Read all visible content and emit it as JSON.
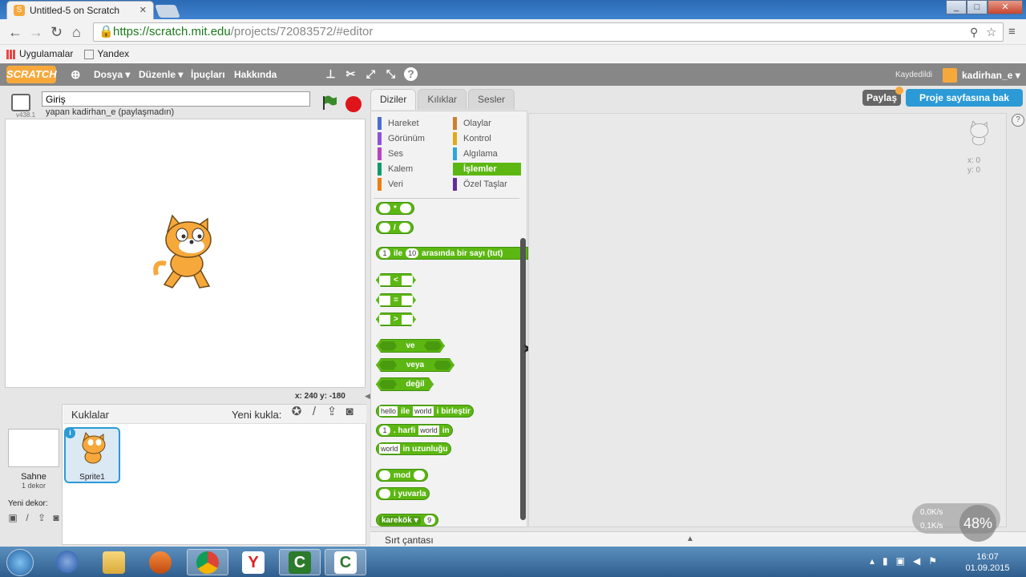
{
  "browser": {
    "tab_title": "Untitled-5 on Scratch",
    "url_scheme": "https://",
    "url_host": "scratch.mit.edu",
    "url_path": "/projects/72083572/#editor",
    "bookmarks": [
      "Uygulamalar",
      "Yandex"
    ]
  },
  "menubar": {
    "logo": "SCRATCH",
    "items": [
      "Dosya ▾",
      "Düzenle ▾",
      "İpuçları",
      "Hakkında"
    ],
    "saved": "Kaydedildi",
    "user": "kadirhan_e ▾"
  },
  "stage": {
    "project_name": "Giriş",
    "byline": "yapan kadirhan_e (paylaşmadın)",
    "version": "v438.1",
    "coords": "x: 240  y: -180"
  },
  "sprites": {
    "header": "Kuklalar",
    "new_sprite": "Yeni kukla:",
    "stage_label": "Sahne",
    "backdrop_count": "1 dekor",
    "new_backdrop": "Yeni dekor:",
    "sprite_name": "Sprite1"
  },
  "tabs": [
    "Diziler",
    "Kılıklar",
    "Sesler"
  ],
  "categories": {
    "left": [
      "Hareket",
      "Görünüm",
      "Ses",
      "Kalem",
      "Veri"
    ],
    "right": [
      "Olaylar",
      "Kontrol",
      "Algılama",
      "İşlemler",
      "Özel Taşlar"
    ],
    "left_colors": [
      "#4a6cd4",
      "#8a55d7",
      "#bb42c3",
      "#0e9a6c",
      "#ee7d16"
    ],
    "right_colors": [
      "#c88330",
      "#e1a91a",
      "#2ca5e2",
      "#5cb712",
      "#632d99"
    ],
    "active": "İşlemler"
  },
  "blocks": {
    "mul": "*",
    "div": "/",
    "random_a": "1",
    "random_mid": "ile",
    "random_b": "10",
    "random_tail": "arasında bir sayı (tut)",
    "lt": "<",
    "eq": "=",
    "gt": ">",
    "and": "ve",
    "or": "veya",
    "not": "değil",
    "join_a": "hello",
    "join_mid": "ile",
    "join_b": "world",
    "join_tail": "i birleştir",
    "letter_n": "1",
    "letter_mid": ". harfi",
    "letter_s": "world",
    "letter_tail": "in",
    "length_s": "world",
    "length_tail": "in uzunluğu",
    "mod": "mod",
    "round": "i yuvarla",
    "sqrt_fn": "karekök ▾",
    "sqrt_n": "9"
  },
  "script_area": {
    "share": "Paylaş",
    "see_page": "Proje sayfasına bak",
    "sprite_x": "x: 0",
    "sprite_y": "y: 0",
    "help": "?"
  },
  "backpack": "Sırt çantası",
  "overlay": {
    "line1": "0,0K/s",
    "line2": "0,1K/s",
    "percent": "48%"
  },
  "taskbar": {
    "time": "16:07",
    "date": "01.09.2015"
  }
}
